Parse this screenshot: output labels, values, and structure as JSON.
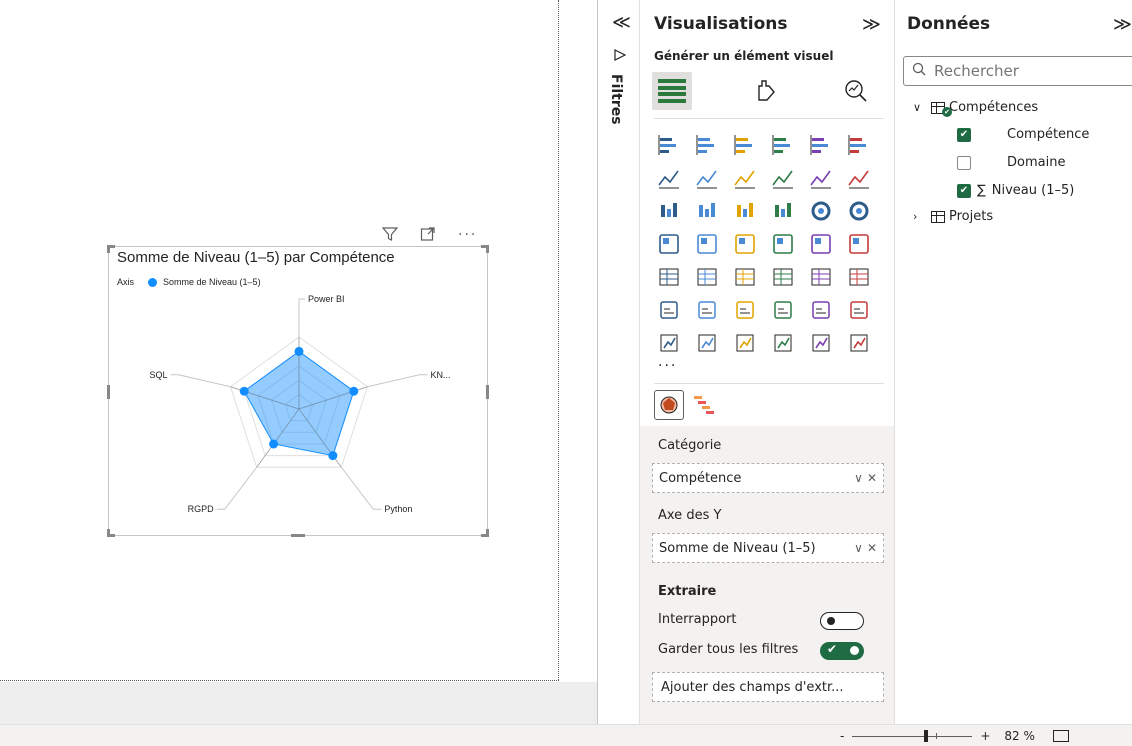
{
  "visual": {
    "filter_icon": "filter-icon",
    "focus_icon": "focus-mode-icon",
    "more_icon": "more-options-icon",
    "more_label": "···"
  },
  "chart_data": {
    "type": "radar",
    "title": "Somme de Niveau (1–5) par Compétence",
    "legend_title": "Axis",
    "legend_placement": "top-left",
    "categories": [
      "Power BI",
      "KN...",
      "Python",
      "RGPD",
      "SQL"
    ],
    "series": [
      {
        "name": "Somme de Niveau (1–5)",
        "values": [
          4,
          4,
          4,
          3,
          4
        ],
        "color": "#118dff"
      }
    ],
    "rmax": 5,
    "rings": 5
  },
  "filters_rail": {
    "label": "Filtres",
    "collapse_glyph": "≪"
  },
  "viz_pane": {
    "title": "Visualisations",
    "collapse_glyph": "≫",
    "subtitle": "Générer un élément visuel",
    "more": "···",
    "wells": {
      "category_label": "Catégorie",
      "category_field": "Compétence",
      "y_label": "Axe des Y",
      "y_field": "Somme de Niveau (1–5)",
      "chevron": "∨",
      "remove": "✕"
    },
    "drill": {
      "title": "Extraire",
      "cross_report_label": "Interrapport",
      "cross_report_on": false,
      "keep_filters_label": "Garder tous les filtres",
      "keep_filters_on": true,
      "add_fields": "Ajouter des champs d'extr..."
    }
  },
  "data_pane": {
    "title": "Données",
    "collapse_glyph": "≫",
    "search_placeholder": "Rechercher",
    "tables": [
      {
        "name": "Compétences",
        "expanded": true,
        "fields": [
          {
            "name": "Compétence",
            "checked": true,
            "sigma": ""
          },
          {
            "name": "Domaine",
            "checked": false,
            "sigma": ""
          },
          {
            "name": "Niveau (1–5)",
            "checked": true,
            "sigma": "∑"
          }
        ]
      },
      {
        "name": "Projets",
        "expanded": false,
        "fields": []
      }
    ]
  },
  "zoom": {
    "minus": "-",
    "plus": "+",
    "value": "82 %"
  }
}
